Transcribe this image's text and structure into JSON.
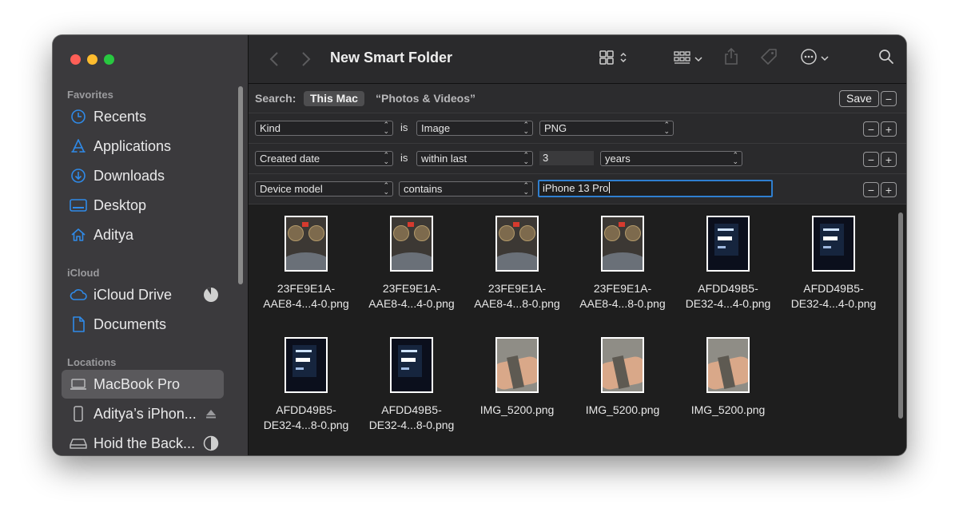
{
  "window": {
    "title": "New Smart Folder"
  },
  "sidebar": {
    "sections": [
      {
        "title": "Favorites",
        "items": [
          {
            "label": "Recents",
            "icon": "clock-icon"
          },
          {
            "label": "Applications",
            "icon": "applications-icon"
          },
          {
            "label": "Downloads",
            "icon": "download-icon"
          },
          {
            "label": "Desktop",
            "icon": "desktop-icon"
          },
          {
            "label": "Aditya",
            "icon": "home-icon"
          }
        ]
      },
      {
        "title": "iCloud",
        "items": [
          {
            "label": "iCloud Drive",
            "icon": "cloud-icon"
          },
          {
            "label": "Documents",
            "icon": "document-icon"
          }
        ]
      },
      {
        "title": "Locations",
        "items": [
          {
            "label": "MacBook Pro",
            "icon": "laptop-icon",
            "selected": true
          },
          {
            "label": "Aditya’s iPhon...",
            "icon": "iphone-icon"
          },
          {
            "label": "Hoid the Back...",
            "icon": "drive-icon"
          }
        ]
      }
    ]
  },
  "search": {
    "label": "Search:",
    "scopes": [
      "This Mac",
      "“Photos & Videos”"
    ],
    "save_label": "Save"
  },
  "rules": [
    {
      "attribute": "Kind",
      "operator": "is",
      "value": "Image",
      "extra": "PNG"
    },
    {
      "attribute": "Created date",
      "operator": "is",
      "value": "within last",
      "amount": "3",
      "unit": "years"
    },
    {
      "attribute": "Device model",
      "operator": "contains",
      "text": "iPhone 13 Pro"
    }
  ],
  "files": [
    {
      "line1": "23FE9E1A-",
      "line2": "AAE8-4...4-0.png",
      "thumb": "dash"
    },
    {
      "line1": "23FE9E1A-",
      "line2": "AAE8-4...4-0.png",
      "thumb": "dash"
    },
    {
      "line1": "23FE9E1A-",
      "line2": "AAE8-4...8-0.png",
      "thumb": "dash"
    },
    {
      "line1": "23FE9E1A-",
      "line2": "AAE8-4...8-0.png",
      "thumb": "dash"
    },
    {
      "line1": "AFDD49B5-",
      "line2": "DE32-4...4-0.png",
      "thumb": "screen"
    },
    {
      "line1": "AFDD49B5-",
      "line2": "DE32-4...4-0.png",
      "thumb": "screen"
    },
    {
      "line1": "AFDD49B5-",
      "line2": "DE32-4...8-0.png",
      "thumb": "screen"
    },
    {
      "line1": "AFDD49B5-",
      "line2": "DE32-4...8-0.png",
      "thumb": "screen"
    },
    {
      "line1": "IMG_5200.png",
      "line2": "",
      "thumb": "wrist"
    },
    {
      "line1": "IMG_5200.png",
      "line2": "",
      "thumb": "wrist"
    },
    {
      "line1": "IMG_5200.png",
      "line2": "",
      "thumb": "wrist"
    }
  ],
  "colors": {
    "accent": "#2f8ae8",
    "focus_ring": "#2f7fd0",
    "sidebar_bg": "#3b3a3d",
    "selected_bg": "#5a595c"
  }
}
